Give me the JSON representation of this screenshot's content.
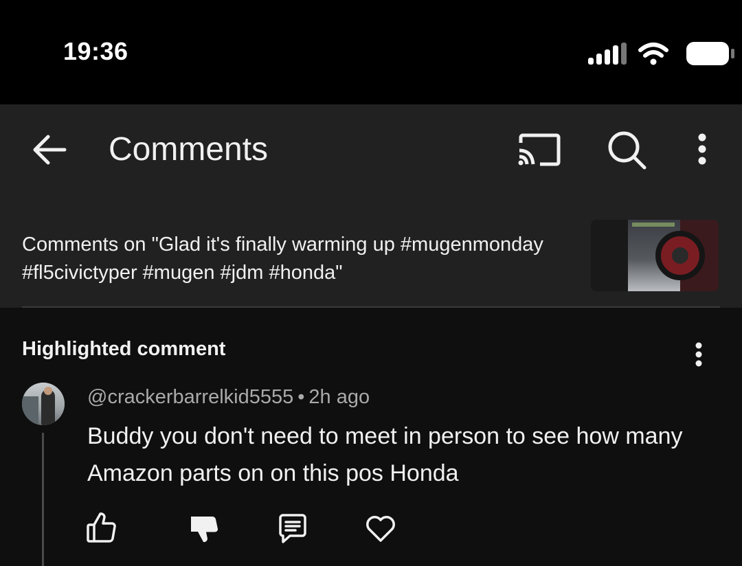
{
  "status_bar": {
    "time": "19:36",
    "icons": [
      "signal-icon",
      "wifi-icon",
      "battery-icon"
    ]
  },
  "app_bar": {
    "title": "Comments",
    "icons": [
      "back-arrow-icon",
      "cast-icon",
      "search-icon",
      "more-vertical-icon"
    ]
  },
  "video": {
    "comments_on_text": "Comments on \"Glad it's finally warming up #mugenmonday  #fl5civictyper #mugen #jdm #honda\""
  },
  "highlighted": {
    "label": "Highlighted comment",
    "comment": {
      "author": "@crackerbarrelkid5555",
      "separator": "•",
      "time": "2h ago",
      "body": "Buddy you don't need to meet in person to see how many Amazon parts on on this pos Honda",
      "actions": [
        "like-icon",
        "dislike-icon",
        "reply-icon",
        "heart-icon"
      ]
    }
  },
  "colors": {
    "background": "#0f0f0f",
    "bar": "#212121",
    "text_primary": "#f1f1f1",
    "text_secondary": "#aaaaaa"
  }
}
